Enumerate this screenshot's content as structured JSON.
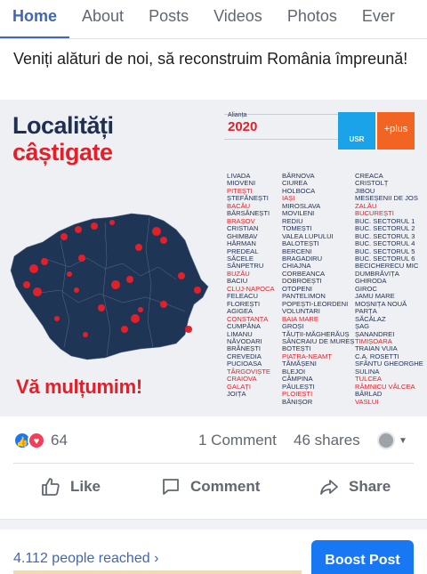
{
  "tabs": [
    "Home",
    "About",
    "Posts",
    "Videos",
    "Photos",
    "Ever"
  ],
  "post": {
    "text": "Veniți alături de noi, să reconstruim România împreună!"
  },
  "image": {
    "headline_line1": "Localități",
    "headline_line2": "câștigate",
    "alliance_label": "Alianța",
    "year": "2020",
    "usr_label": "USR",
    "plus_label": "+plus",
    "thanks": "Vă mulțumim!",
    "highlight_color": "#e3202a",
    "text_color": "#1f2f52",
    "columns": [
      [
        {
          "n": "LIVADA",
          "r": false
        },
        {
          "n": "MIOVENI",
          "r": false
        },
        {
          "n": "PITEȘTI",
          "r": true
        },
        {
          "n": "ȘTEFĂNEȘTI",
          "r": false
        },
        {
          "n": "BACĂU",
          "r": true
        },
        {
          "n": "BĂRSĂNEȘTI",
          "r": false
        },
        {
          "n": "BRAȘOV",
          "r": true
        },
        {
          "n": "CRISTIAN",
          "r": false
        },
        {
          "n": "GHIMBAV",
          "r": false
        },
        {
          "n": "HĂRMAN",
          "r": false
        },
        {
          "n": "PREDEAL",
          "r": false
        },
        {
          "n": "SĂCELE",
          "r": false
        },
        {
          "n": "SÂNPETRU",
          "r": false
        },
        {
          "n": "BUZĂU",
          "r": true
        },
        {
          "n": "BACIU",
          "r": false
        },
        {
          "n": "CLUJ-NAPOCA",
          "r": true
        },
        {
          "n": "FELEACU",
          "r": false
        },
        {
          "n": "FLOREȘTI",
          "r": false
        },
        {
          "n": "AGIGEA",
          "r": false
        },
        {
          "n": "CONSTANȚA",
          "r": true
        },
        {
          "n": "CUMPĂNA",
          "r": false
        },
        {
          "n": "LIMANU",
          "r": false
        },
        {
          "n": "NĂVODARI",
          "r": false
        },
        {
          "n": "BRĂNEȘTI",
          "r": false
        },
        {
          "n": "CREVEDIA",
          "r": false
        },
        {
          "n": "PUCIOASA",
          "r": false
        },
        {
          "n": "TÂRGOVIȘTE",
          "r": true
        },
        {
          "n": "CRAIOVA",
          "r": true
        },
        {
          "n": "GALAȚI",
          "r": true
        },
        {
          "n": "JOIȚA",
          "r": false
        }
      ],
      [
        {
          "n": "BĂRNOVA",
          "r": false
        },
        {
          "n": "CIUREA",
          "r": false
        },
        {
          "n": "HOLBOCA",
          "r": false
        },
        {
          "n": "IAȘI",
          "r": true
        },
        {
          "n": "MIROSLAVA",
          "r": false
        },
        {
          "n": "MOVILENI",
          "r": false
        },
        {
          "n": "REDIU",
          "r": false
        },
        {
          "n": "TOMEȘTI",
          "r": false
        },
        {
          "n": "VALEA LUPULUI",
          "r": false
        },
        {
          "n": "BALOTEȘTI",
          "r": false
        },
        {
          "n": "BERCENI",
          "r": false
        },
        {
          "n": "BRAGADIRU",
          "r": false
        },
        {
          "n": "CHIAJNA",
          "r": false
        },
        {
          "n": "CORBEANCA",
          "r": false
        },
        {
          "n": "DOBROEȘTI",
          "r": false
        },
        {
          "n": "OTOPENI",
          "r": false
        },
        {
          "n": "PANTELIMON",
          "r": false
        },
        {
          "n": "POPEȘTI-LEORDENI",
          "r": false
        },
        {
          "n": "VOLUNTARI",
          "r": false
        },
        {
          "n": "BAIA MARE",
          "r": true
        },
        {
          "n": "GROȘI",
          "r": false
        },
        {
          "n": "TĂUȚII-MĂGHERĂUȘ",
          "r": false
        },
        {
          "n": "SÂNCRAIU DE MUREȘ",
          "r": false
        },
        {
          "n": "BOTEȘTI",
          "r": false
        },
        {
          "n": "PIATRA-NEAMȚ",
          "r": true
        },
        {
          "n": "TĂMĂȘENI",
          "r": false
        },
        {
          "n": "BLEJOI",
          "r": false
        },
        {
          "n": "CÂMPINA",
          "r": false
        },
        {
          "n": "PĂULEȘTI",
          "r": false
        },
        {
          "n": "PLOIEȘTI",
          "r": true
        },
        {
          "n": "BĂNIȘOR",
          "r": false
        }
      ],
      [
        {
          "n": "CREACA",
          "r": false
        },
        {
          "n": "CRISTOLȚ",
          "r": false
        },
        {
          "n": "JIBOU",
          "r": false
        },
        {
          "n": "MESEȘENII DE JOS",
          "r": false
        },
        {
          "n": "ZALĂU",
          "r": true
        },
        {
          "n": "BUCUREȘTI",
          "r": true
        },
        {
          "n": "BUC. SECTORUL 1",
          "r": false
        },
        {
          "n": "BUC. SECTORUL 2",
          "r": false
        },
        {
          "n": "BUC. SECTORUL 3",
          "r": false
        },
        {
          "n": "BUC. SECTORUL 4",
          "r": false
        },
        {
          "n": "BUC. SECTORUL 5",
          "r": false
        },
        {
          "n": "BUC. SECTORUL 6",
          "r": false
        },
        {
          "n": "BECICHERECU MIC",
          "r": false
        },
        {
          "n": "DUMBRĂVIȚA",
          "r": false
        },
        {
          "n": "GHIRODA",
          "r": false
        },
        {
          "n": "GIROC",
          "r": false
        },
        {
          "n": "JAMU MARE",
          "r": false
        },
        {
          "n": "MOȘNIȚA NOUĂ",
          "r": false
        },
        {
          "n": "PARȚA",
          "r": false
        },
        {
          "n": "SĂCĂLAZ",
          "r": false
        },
        {
          "n": "ȘAG",
          "r": false
        },
        {
          "n": "ȘANANDREI",
          "r": false
        },
        {
          "n": "TIMIȘOARA",
          "r": true
        },
        {
          "n": "TRAIAN VUIA",
          "r": false
        },
        {
          "n": "C.A. ROSETTI",
          "r": false
        },
        {
          "n": "SFÂNTU GHEORGHE",
          "r": false
        },
        {
          "n": "SULINA",
          "r": false
        },
        {
          "n": "TULCEA",
          "r": true
        },
        {
          "n": "RÂMNICU VÂLCEA",
          "r": true
        },
        {
          "n": "BÂRLAD",
          "r": false
        },
        {
          "n": "VASLUI",
          "r": true
        }
      ]
    ]
  },
  "stats": {
    "reaction_count": "64",
    "comments": "1 Comment",
    "shares": "46 shares"
  },
  "actions": {
    "like": "Like",
    "comment": "Comment",
    "share": "Share"
  },
  "footer": {
    "reached": "4.112 people reached",
    "boost": "Boost Post"
  }
}
